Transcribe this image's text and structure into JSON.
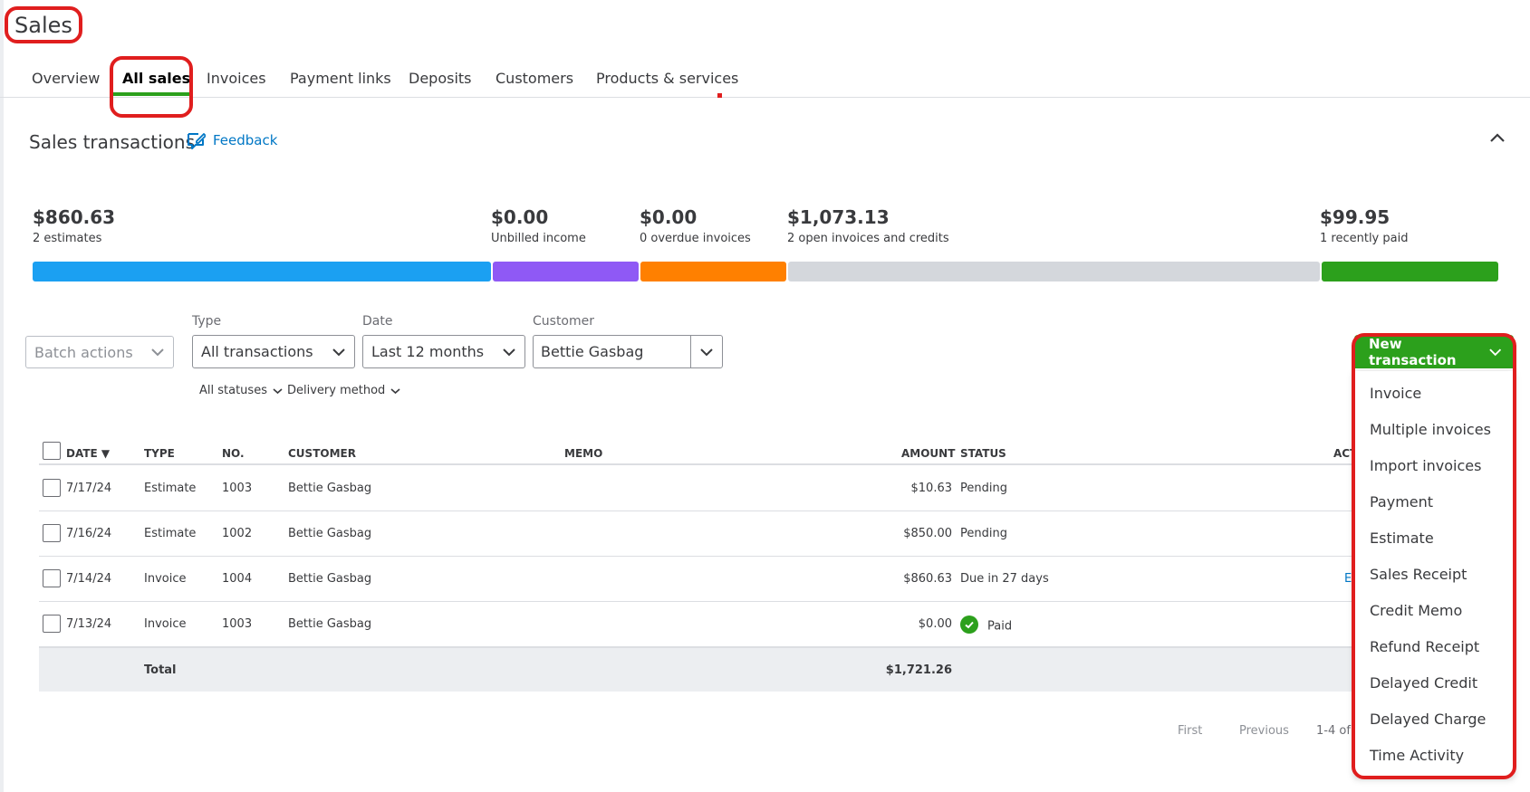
{
  "page": {
    "title": "Sales"
  },
  "tabs": [
    {
      "label": "Overview"
    },
    {
      "label": "All sales"
    },
    {
      "label": "Invoices"
    },
    {
      "label": "Payment links"
    },
    {
      "label": "Deposits"
    },
    {
      "label": "Customers"
    },
    {
      "label": "Products & services"
    }
  ],
  "section": {
    "title": "Sales transactions",
    "feedback_label": "Feedback"
  },
  "stats": [
    {
      "amount": "$860.63",
      "label": "2 estimates",
      "color": "#1ba0f2"
    },
    {
      "amount": "$0.00",
      "label": "Unbilled income",
      "color": "#8f59f5"
    },
    {
      "amount": "$0.00",
      "label": "0 overdue invoices",
      "color": "#ff8000"
    },
    {
      "amount": "$1,073.13",
      "label": "2 open invoices and credits",
      "color": "#d4d7dc"
    },
    {
      "amount": "$99.95",
      "label": "1 recently paid",
      "color": "#2ca01c"
    }
  ],
  "filters": {
    "batch_actions": "Batch actions",
    "type_label": "Type",
    "type_value": "All transactions",
    "date_label": "Date",
    "date_value": "Last 12 months",
    "customer_label": "Customer",
    "customer_value": "Bettie Gasbag",
    "statuses": "All statuses",
    "delivery": "Delivery method"
  },
  "table": {
    "headers": {
      "date": "DATE ▼",
      "type": "TYPE",
      "no": "NO.",
      "customer": "CUSTOMER",
      "memo": "MEMO",
      "amount": "AMOUNT",
      "status": "STATUS",
      "action": "ACT"
    },
    "rows": [
      {
        "date": "7/17/24",
        "type": "Estimate",
        "no": "1003",
        "customer": "Bettie Gasbag",
        "amount": "$10.63",
        "status": "Pending"
      },
      {
        "date": "7/16/24",
        "type": "Estimate",
        "no": "1002",
        "customer": "Bettie Gasbag",
        "amount": "$850.00",
        "status": "Pending"
      },
      {
        "date": "7/14/24",
        "type": "Invoice",
        "no": "1004",
        "customer": "Bettie Gasbag",
        "amount": "$860.63",
        "status": "Due in 27 days",
        "action": "E"
      },
      {
        "date": "7/13/24",
        "type": "Invoice",
        "no": "1003",
        "customer": "Bettie Gasbag",
        "amount": "$0.00",
        "status": "Paid"
      }
    ],
    "total_label": "Total",
    "total_amount": "$1,721.26"
  },
  "pager": {
    "first": "First",
    "previous": "Previous",
    "range": "1-4 of"
  },
  "new_transaction": {
    "label": "New transaction",
    "items": [
      "Invoice",
      "Multiple invoices",
      "Import invoices",
      "Payment",
      "Estimate",
      "Sales Receipt",
      "Credit Memo",
      "Refund Receipt",
      "Delayed Credit",
      "Delayed Charge",
      "Time Activity"
    ]
  },
  "colors": {
    "accent": "#2ca01c",
    "link": "#0077c5",
    "highlight": "#e01e1e"
  }
}
